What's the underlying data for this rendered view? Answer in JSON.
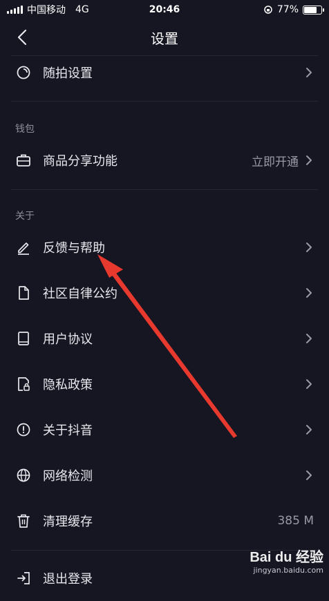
{
  "status": {
    "carrier": "中国移动",
    "network": "4G",
    "time": "20:46",
    "battery": "77%",
    "battery_level": 0.77
  },
  "nav": {
    "title": "设置",
    "back_icon": "chevron-left-icon"
  },
  "rows": {
    "suipai": {
      "label": "随拍设置",
      "icon": "camera-circle-icon"
    },
    "goods": {
      "label": "商品分享功能",
      "value": "立即开通",
      "icon": "briefcase-icon"
    },
    "feedback": {
      "label": "反馈与帮助",
      "icon": "pencil-icon"
    },
    "community": {
      "label": "社区自律公约",
      "icon": "document-icon"
    },
    "agreement": {
      "label": "用户协议",
      "icon": "book-icon"
    },
    "privacy": {
      "label": "隐私政策",
      "icon": "lock-document-icon"
    },
    "about": {
      "label": "关于抖音",
      "icon": "info-circle-icon"
    },
    "network": {
      "label": "网络检测",
      "icon": "globe-icon"
    },
    "cache": {
      "label": "清理缓存",
      "value": "385 M",
      "icon": "trash-icon"
    },
    "logout": {
      "label": "退出登录",
      "icon": "logout-icon"
    }
  },
  "sections": {
    "wallet": "钱包",
    "about": "关于"
  },
  "watermark": {
    "logo": "Bai du 经验",
    "url": "jingyan.baidu.com"
  },
  "colors": {
    "background": "#161622",
    "text": "#e8e8ee",
    "muted": "#8f8f9b",
    "arrow": "#e8392f"
  }
}
